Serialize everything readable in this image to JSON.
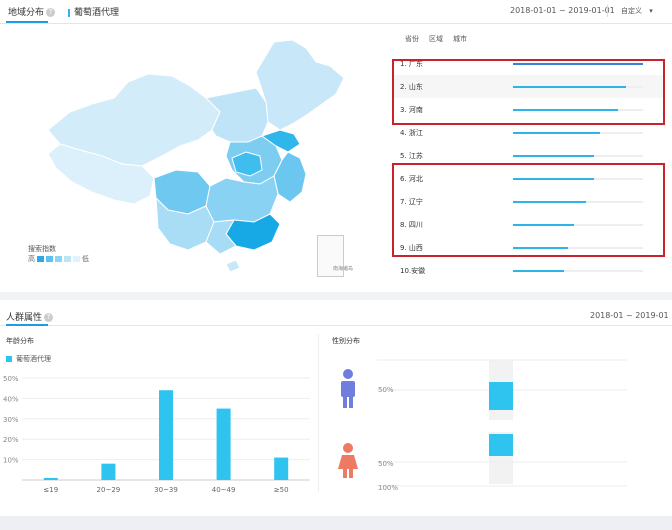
{
  "header": {
    "tab_region": "地域分布",
    "tab_keyword": "葡萄酒代理",
    "date_range": "2018-01-01 ~ 2019-01-01",
    "custom_label": "自定义"
  },
  "map": {
    "legend_title": "搜索指数",
    "legend_high": "高",
    "legend_low": "低",
    "legend_colors": [
      "#2fa9e6",
      "#5ec0ee",
      "#8fd3f4",
      "#bde5f8",
      "#e0f3fc"
    ],
    "inset_label": "南海诸岛"
  },
  "ranking": {
    "tabs": [
      "省份",
      "区域",
      "城市"
    ],
    "rows": [
      {
        "label": "1. 广东",
        "value": 1.0
      },
      {
        "label": "2. 山东",
        "value": 0.87
      },
      {
        "label": "3. 河南",
        "value": 0.81
      },
      {
        "label": "4. 浙江",
        "value": 0.67
      },
      {
        "label": "5. 江苏",
        "value": 0.62
      },
      {
        "label": "6. 河北",
        "value": 0.62
      },
      {
        "label": "7. 辽宁",
        "value": 0.56
      },
      {
        "label": "8. 四川",
        "value": 0.47
      },
      {
        "label": "9. 山西",
        "value": 0.42
      },
      {
        "label": "10.安徽",
        "value": 0.39
      }
    ]
  },
  "people": {
    "title": "人群属性",
    "date_range": "2018-01 ~ 2019-01",
    "age_title": "年龄分布",
    "age_legend": "葡萄酒代理",
    "gender_title": "性别分布"
  },
  "chart_data": [
    {
      "type": "bar",
      "categories": [
        "≤19",
        "20~29",
        "30~39",
        "40~49",
        "≥50"
      ],
      "values": [
        1,
        8,
        44,
        35,
        11
      ],
      "yticks": [
        "50%",
        "40%",
        "30%",
        "20%",
        "10%"
      ],
      "ylim": [
        0,
        50
      ],
      "color": "#2fc3ef"
    },
    {
      "type": "bar",
      "categories": [
        "男",
        "女"
      ],
      "ticks_male": [
        "50%"
      ],
      "ticks_female": [
        "50%",
        "100%"
      ],
      "male_color": "#6f7ddf",
      "female_color": "#ef7a63"
    }
  ]
}
